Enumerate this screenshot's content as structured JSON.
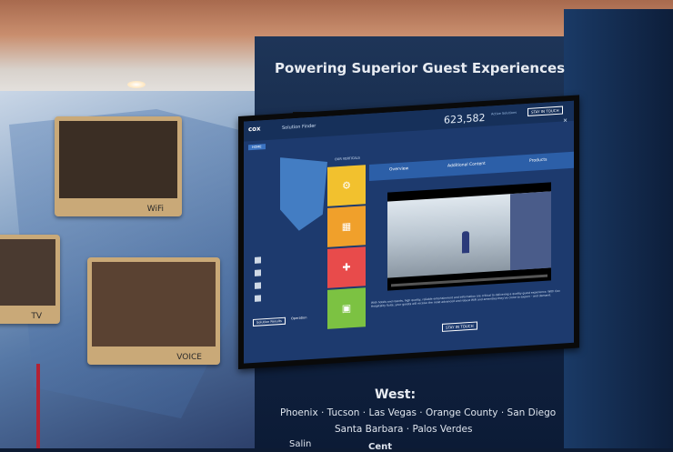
{
  "wall": {
    "title": "Powering Superior Guest Experiences",
    "panels": [
      {
        "label": "WiFi"
      },
      {
        "label": "TV"
      },
      {
        "label": "VOICE"
      }
    ],
    "region_title": "West:",
    "cities_line1": "Phoenix · Tucson · Las Vegas · Orange County · San Diego",
    "cities_line2": "Santa Barbara · Palos Verdes",
    "cities_line3": "Salin",
    "cities_line4": "Cent"
  },
  "screen": {
    "logo": "cox",
    "title": "Solution Finder",
    "counter": "623,582",
    "counter_label": "Active Solutions",
    "stay_button": "STAY IN TOUCH",
    "close": "✕",
    "home_button": "HOME",
    "verticals_label": "OUR VERTICALS",
    "tabs": [
      "Overview",
      "Additional Content",
      "Products"
    ],
    "tiles": [
      {
        "color": "#f2c12e",
        "icon": "gear-icon"
      },
      {
        "color": "#f0a02b",
        "icon": "building-icon"
      },
      {
        "color": "#e84b4b",
        "icon": "cross-icon"
      },
      {
        "color": "#7cc242",
        "icon": "briefcase-icon"
      }
    ],
    "body_text": "With hotels and resorts, high quality, reliable entertainment and information are critical to delivering a quality guest experience. With Cox Hospitality Suite, your guests will receive the most advanced and robust WiFi and amenities they've come to expect – and demand.",
    "stay_button2": "STAY IN TOUCH",
    "footer_btn1": "Solution Results",
    "footer_btn2": "Operation"
  }
}
